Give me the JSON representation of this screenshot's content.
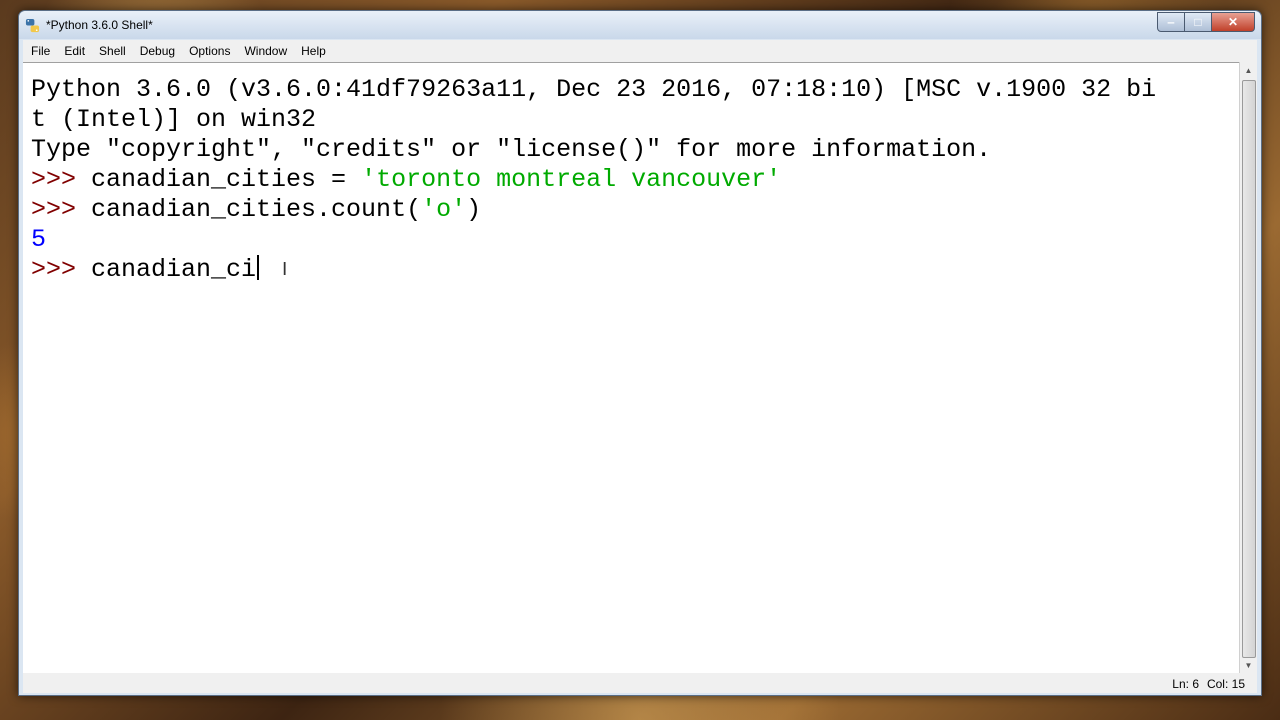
{
  "window": {
    "title": "*Python 3.6.0 Shell*"
  },
  "controls": {
    "minimize": "‒",
    "maximize": "□",
    "close": "✕"
  },
  "menu": [
    "File",
    "Edit",
    "Shell",
    "Debug",
    "Options",
    "Window",
    "Help"
  ],
  "shell": {
    "banner_line1": "Python 3.6.0 (v3.6.0:41df79263a11, Dec 23 2016, 07:18:10) [MSC v.1900 32 bi",
    "banner_line2": "t (Intel)] on win32",
    "banner_line3": "Type \"copyright\", \"credits\" or \"license()\" for more information.",
    "prompt": ">>> ",
    "cmd1_code": "canadian_cities = ",
    "cmd1_string": "'toronto montreal vancouver'",
    "cmd2_code_a": "canadian_cities.count(",
    "cmd2_string": "'o'",
    "cmd2_code_b": ")",
    "output1": "5",
    "current_input": "canadian_ci"
  },
  "status": {
    "ln": "Ln: 6",
    "col": "Col: 15"
  },
  "colors": {
    "prompt": "#800000",
    "string": "#00aa00",
    "output": "#0000ff"
  }
}
